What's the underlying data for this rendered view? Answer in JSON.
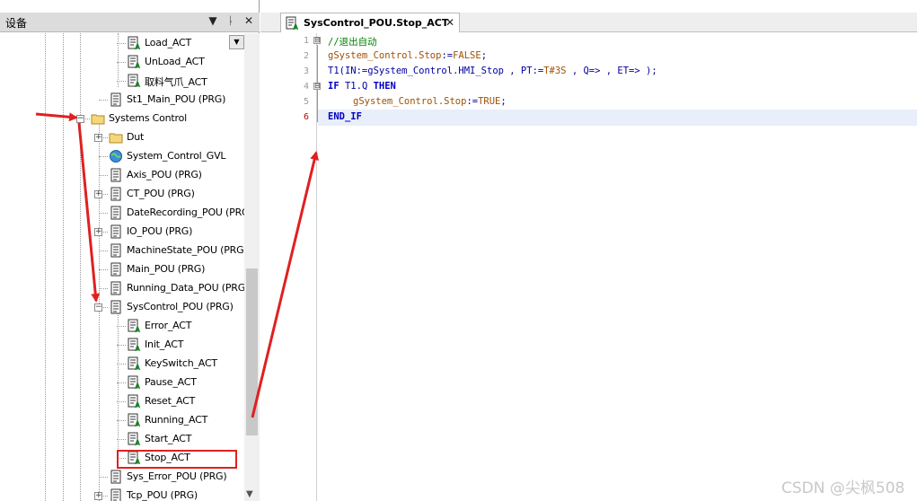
{
  "left_panel": {
    "title": "设备",
    "buttons": {
      "dropdown": "▼",
      "pin": "ᚿ",
      "close": "✕"
    }
  },
  "tree": [
    {
      "label": "Load_ACT",
      "icon": "action-icon"
    },
    {
      "label": "UnLoad_ACT",
      "icon": "action-icon"
    },
    {
      "label": "取料气爪_ACT",
      "icon": "action-icon"
    },
    {
      "label": "St1_Main_POU (PRG)",
      "icon": "pou-icon"
    },
    {
      "label": "Systems Control",
      "icon": "folder-icon"
    },
    {
      "label": "Dut",
      "icon": "folder-icon"
    },
    {
      "label": "System_Control_GVL",
      "icon": "globe-icon"
    },
    {
      "label": "Axis_POU (PRG)",
      "icon": "pou-icon"
    },
    {
      "label": "CT_POU (PRG)",
      "icon": "pou-icon"
    },
    {
      "label": "DateRecording_POU (PRG)",
      "icon": "pou-icon"
    },
    {
      "label": "IO_POU (PRG)",
      "icon": "pou-icon"
    },
    {
      "label": "MachineState_POU (PRG)",
      "icon": "pou-icon"
    },
    {
      "label": "Main_POU (PRG)",
      "icon": "pou-icon"
    },
    {
      "label": "Running_Data_POU (PRG)",
      "icon": "pou-icon"
    },
    {
      "label": "SysControl_POU (PRG)",
      "icon": "pou-icon"
    },
    {
      "label": "Error_ACT",
      "icon": "action-icon"
    },
    {
      "label": "Init_ACT",
      "icon": "action-icon"
    },
    {
      "label": "KeySwitch_ACT",
      "icon": "action-icon"
    },
    {
      "label": "Pause_ACT",
      "icon": "action-icon"
    },
    {
      "label": "Reset_ACT",
      "icon": "action-icon"
    },
    {
      "label": "Running_ACT",
      "icon": "action-icon"
    },
    {
      "label": "Start_ACT",
      "icon": "action-icon"
    },
    {
      "label": "Stop_ACT",
      "icon": "action-icon"
    },
    {
      "label": "Sys_Error_POU (PRG)",
      "icon": "pou-icon"
    },
    {
      "label": "Tcp_POU (PRG)",
      "icon": "pou-icon"
    }
  ],
  "editor": {
    "tab_label": "SysControl_POU.Stop_ACT",
    "tab_close": "✕",
    "line_numbers": [
      "1",
      "2",
      "3",
      "4",
      "5",
      "6"
    ],
    "fold_markers": [
      "⊟",
      "⊟"
    ],
    "code": {
      "l1_comment": "//退出自动",
      "l2_var": "gSystem_Control.Stop",
      "l2_op": ":=",
      "l2_val": "FALSE",
      "l2_end": ";",
      "l3_a": "T1(IN:=gSystem_Control.HMI_Stop , PT:=",
      "l3_time": "T#3S",
      "l3_b": " , Q=> , ET=> );",
      "l4_if": "IF",
      "l4_cond": " T1.Q ",
      "l4_then": "THEN",
      "l5_var": "gSystem_Control.Stop",
      "l5_op": ":=",
      "l5_val": "TRUE",
      "l5_end": ";",
      "l6_endif": "END_IF"
    }
  },
  "watermark": "CSDN @尖枫508",
  "colors": {
    "annotation": "#e02020",
    "keyword": "#0000c0",
    "comment": "#008000"
  }
}
